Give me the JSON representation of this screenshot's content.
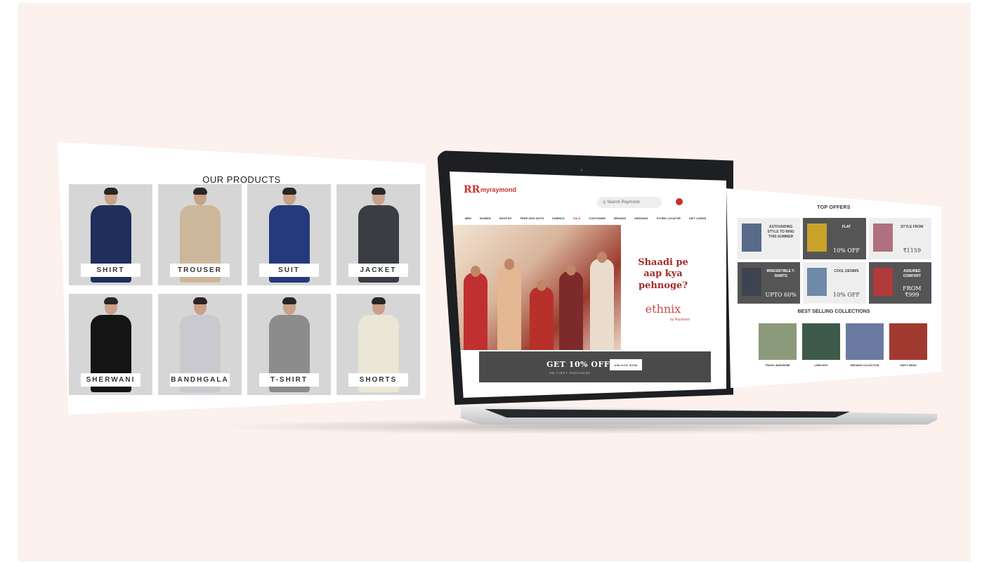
{
  "left_panel": {
    "title": "OUR PRODUCTS",
    "products": [
      {
        "label": "SHIRT",
        "color": "#1f2f5a"
      },
      {
        "label": "TROUSER",
        "color": "#cdb79a"
      },
      {
        "label": "SUIT",
        "color": "#243a7a"
      },
      {
        "label": "JACKET",
        "color": "#3a3d44"
      },
      {
        "label": "SHERWANI",
        "color": "#141414"
      },
      {
        "label": "BANDHGALA",
        "color": "#c9c9cf"
      },
      {
        "label": "T-SHIRT",
        "color": "#8c8c8c"
      },
      {
        "label": "SHORTS",
        "color": "#ece6d6"
      }
    ]
  },
  "laptop_site": {
    "logo_mark": "RR",
    "logo_text": "myraymond",
    "search_placeholder": "Search Raymond",
    "nav": [
      "MEN",
      "WOMEN",
      "SHOP BY",
      "FREE SIZE SUITS",
      "FABRICS",
      "SALE",
      "CUSTOMISE",
      "BRANDS",
      "WEDDING",
      "STORE LOCATOR",
      "GIFT CARDS"
    ],
    "tagline": "Shaadi pe aap kya pehnoge?",
    "brand": "ethnix",
    "brand_sub": "by Raymond",
    "promo_big": "GET 10% OFF",
    "promo_small": "ON FIRST PURCHASE",
    "promo_button": "UNLOCK NOW"
  },
  "right_panel": {
    "title": "TOP OFFERS",
    "offers": [
      {
        "text": "ASTOUNDING STYLE TO RING THIS SUMMER",
        "sub": "",
        "style": "light"
      },
      {
        "text": "FLAT",
        "sub": "10% OFF",
        "style": "dark"
      },
      {
        "text": "STYLE FROM",
        "sub": "₹1159",
        "style": "light"
      },
      {
        "text": "IRRESISTIBLE T-SHIRTS",
        "sub": "UPTO 60%",
        "style": "dark"
      },
      {
        "text": "COOL DENIMS",
        "sub": "10% OFF",
        "style": "light"
      },
      {
        "text": "ASSURED COMFORT",
        "sub": "FROM ₹999",
        "style": "dark"
      }
    ],
    "best_title": "BEST SELLING COLLECTIONS",
    "collections": [
      {
        "caption": "TRAVEL WARDROBE"
      },
      {
        "caption": "LINEN EDIT"
      },
      {
        "caption": "WEDDING COLLECTION"
      },
      {
        "caption": "PARTY WEAR"
      }
    ]
  }
}
